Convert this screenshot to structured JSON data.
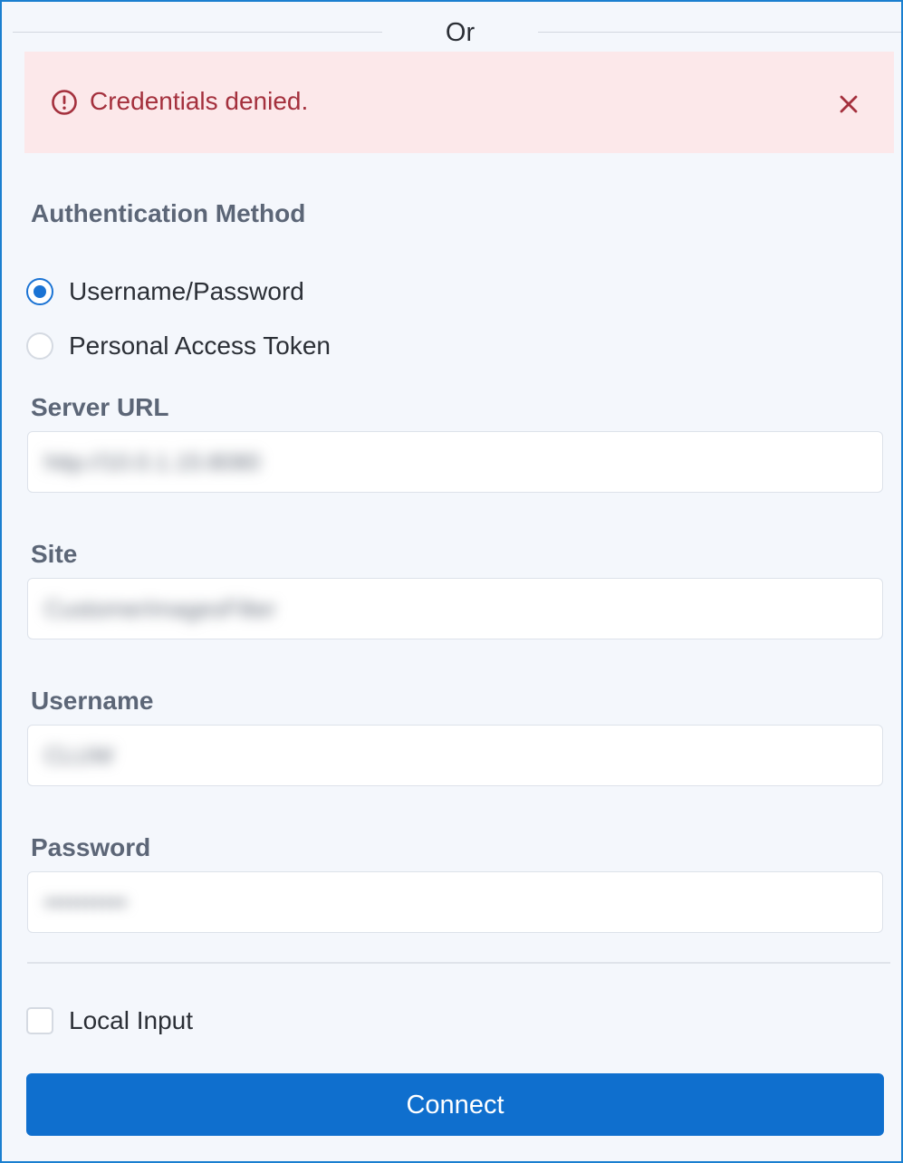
{
  "divider": {
    "label": "Or"
  },
  "alert": {
    "message": "Credentials denied.",
    "icon": "alert-circle-icon",
    "close_icon": "close-icon",
    "text_color": "#a4303d",
    "background": "#fce8ea"
  },
  "auth": {
    "title": "Authentication Method",
    "options": [
      {
        "label": "Username/Password",
        "selected": true
      },
      {
        "label": "Personal Access Token",
        "selected": false
      }
    ]
  },
  "fields": {
    "server_url": {
      "label": "Server URL",
      "value": "http://10.0.1.15:8080"
    },
    "site": {
      "label": "Site",
      "value": "CustomerImagesFilter"
    },
    "username": {
      "label": "Username",
      "value": "CLUW"
    },
    "password": {
      "label": "Password",
      "value": "••••••••••"
    }
  },
  "local_input": {
    "label": "Local Input",
    "checked": false
  },
  "connect": {
    "label": "Connect",
    "color": "#0f6fce"
  },
  "colors": {
    "accent": "#1a73d4",
    "frame_border": "#1a7fd0"
  }
}
